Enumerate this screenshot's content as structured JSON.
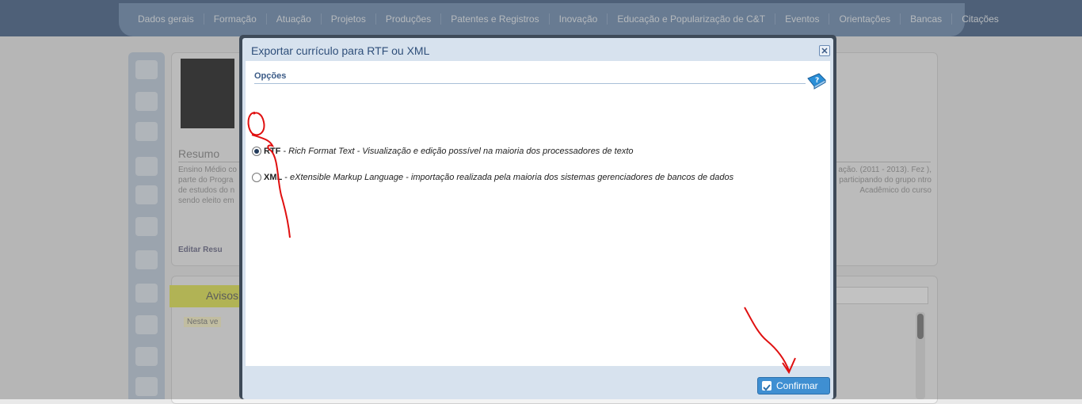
{
  "nav": {
    "items": [
      "Dados gerais",
      "Formação",
      "Atuação",
      "Projetos",
      "Produções",
      "Patentes e Registros",
      "Inovação",
      "Educação e Popularização de C&T",
      "Eventos",
      "Orientações",
      "Bancas",
      "Citações"
    ]
  },
  "background": {
    "resumo_title": "Resumo",
    "resumo_text_left": "Ensino Médio co parte do Progra de estudos do n sendo eleito em",
    "resumo_text_right": "ação. (2011 - 2013). Fez ), participando do grupo ntro Acadêmico do curso",
    "edit_resumo": "Editar Resu",
    "avisos": "Avisos",
    "nesta": "Nesta ve"
  },
  "dialog": {
    "title": "Exportar currículo para RTF ou XML",
    "options_legend": "Opções",
    "options": [
      {
        "code": "RTF",
        "sep": " - ",
        "desc": "Rich Format Text - Visualização e edição possível na maioria dos processadores de texto",
        "selected": true
      },
      {
        "code": "XML",
        "sep": " - ",
        "desc": "eXtensible Markup Language - importação realizada pela maioria dos sistemas gerenciadores de bancos de dados",
        "selected": false
      }
    ],
    "confirm_label": "Confirmar"
  },
  "colors": {
    "nav_dark": "#2c4d78",
    "nav_band": "#5b7ea8",
    "dialog_header": "#d7e2ee",
    "confirm": "#3f8fd2",
    "annotation": "#e01010"
  }
}
